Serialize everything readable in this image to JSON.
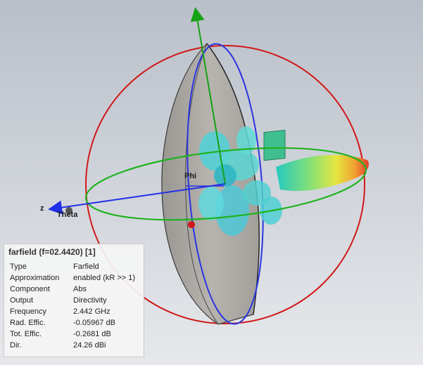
{
  "axes": {
    "z_label": "z",
    "phi_label": "Phi",
    "theta_label": "Theta"
  },
  "info_panel": {
    "title": "farfield (f=02.4420) [1]",
    "rows": [
      {
        "key": "Type",
        "value": "Farfield"
      },
      {
        "key": "Approximation",
        "value": "enabled (kR >> 1)"
      },
      {
        "key": "Component",
        "value": "Abs"
      },
      {
        "key": "Output",
        "value": "Directivity"
      },
      {
        "key": "Frequency",
        "value": "2.442 GHz"
      },
      {
        "key": "Rad. Effic.",
        "value": "-0.05967 dB"
      },
      {
        "key": "Tot. Effic.",
        "value": "-0.2681 dB"
      },
      {
        "key": "Dir.",
        "value": "24.26 dBi"
      }
    ]
  },
  "colors": {
    "circle_red": "#d01818",
    "circle_blue": "#2b35e0",
    "circle_green": "#1fb31f",
    "axis_green": "#16a116",
    "axis_blue": "#1f2fe8",
    "dish": "#a9a6a2",
    "lobe_cyan": "#4fd1d6"
  },
  "icons": [
    "axis-arrow-icon"
  ]
}
